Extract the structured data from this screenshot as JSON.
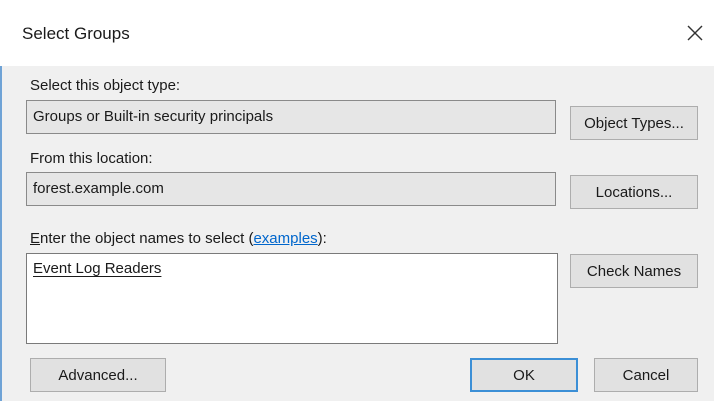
{
  "window": {
    "title": "Select Groups",
    "close_icon": "close-icon"
  },
  "object_type": {
    "label": "Select this object type:",
    "value": "Groups or Built-in security principals",
    "button_label": "Object Types..."
  },
  "location": {
    "label": "From this location:",
    "value": "forest.example.com",
    "button_label": "Locations..."
  },
  "names": {
    "label_mnemonic": "E",
    "label_rest": "nter the object names to select (",
    "examples_link": "examples",
    "label_suffix": "):",
    "entries": [
      "Event Log Readers"
    ],
    "check_names_label": "Check Names"
  },
  "footer": {
    "advanced_label": "Advanced...",
    "ok_label": "OK",
    "cancel_label": "Cancel"
  },
  "colors": {
    "link": "#0066cc",
    "primary_border": "#3c8fd6",
    "accent_left": "#6fa3d6"
  }
}
